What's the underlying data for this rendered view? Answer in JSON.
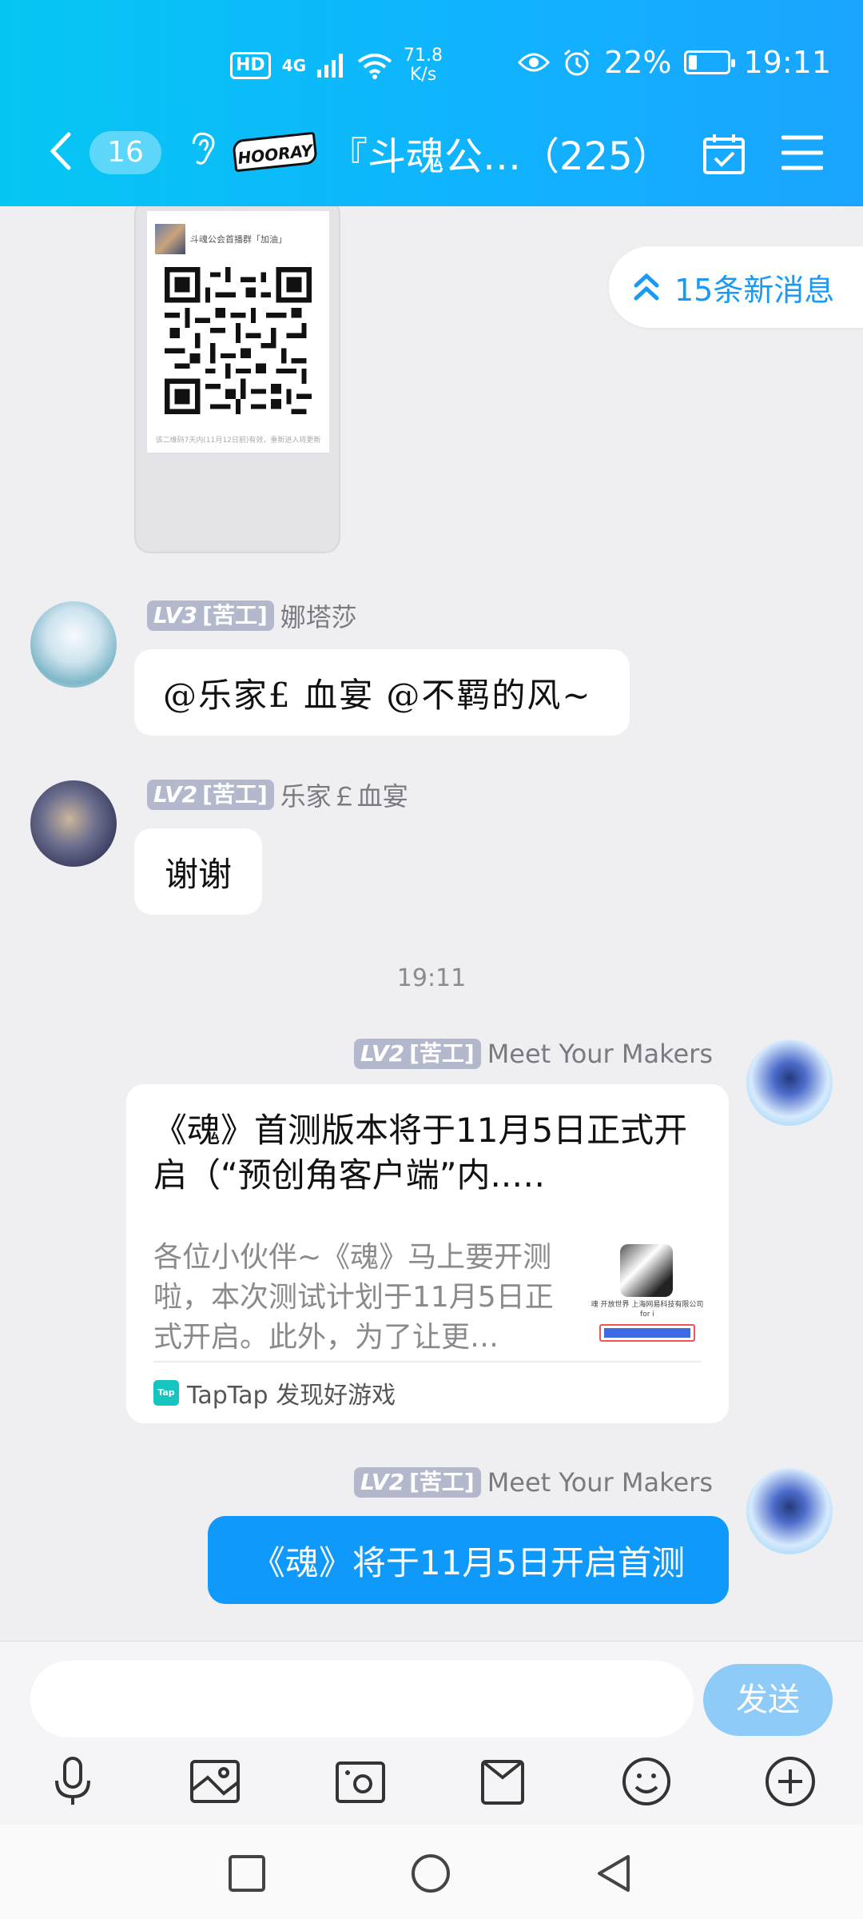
{
  "status_bar": {
    "hd": "HD",
    "network": "4G",
    "speed_value": "71.8",
    "speed_unit": "K/s",
    "battery": "22%",
    "time": "19:11"
  },
  "header": {
    "unread_count": "16",
    "logo_text": "HOORAY",
    "title": "『斗魂公…（225）"
  },
  "new_messages": "15条新消息",
  "qr_card": {
    "header_text": "斗魂公会首播群「加油」",
    "footer_text": "该二维码7天内(11月12日前)有效，重新进入将更新"
  },
  "messages": [
    {
      "level": "LV3",
      "rank": "[苦工]",
      "sender": "娜塔莎",
      "text": "@乐家£ 血宴 @不羁的风~"
    },
    {
      "level": "LV2",
      "rank": "[苦工]",
      "sender": "乐家￡血宴",
      "text": "谢谢"
    }
  ],
  "time_divider": "19:11",
  "share_message": {
    "level": "LV2",
    "rank": "[苦工]",
    "sender": "Meet Your Makers",
    "title": "《魂》首测版本将于11月5日正式开启（“预创角客户端”内..…",
    "desc": "各位小伙伴~《魂》马上要开测啦，本次测试计划于11月5日正式开启。此外，为了让更…",
    "thumb_text": "魂 开放世界 上海网易科技有限公司 for i",
    "source": "TapTap 发现好游戏",
    "source_icon": "Tap"
  },
  "last_message": {
    "level": "LV2",
    "rank": "[苦工]",
    "sender": "Meet Your Makers",
    "text": "《魂》将于11月5日开启首测"
  },
  "input": {
    "placeholder": "",
    "send_label": "发送"
  },
  "tools": [
    "mic-icon",
    "image-icon",
    "camera-icon",
    "file-icon",
    "emoji-icon",
    "plus-icon"
  ],
  "colors": {
    "header": "#11b2ff",
    "accent": "#0e99fb",
    "send_disabled": "#8ecbf8"
  }
}
